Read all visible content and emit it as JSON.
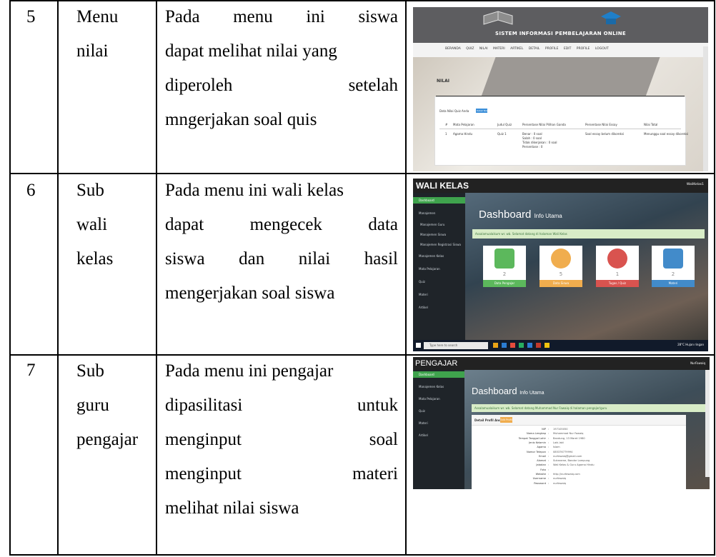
{
  "rows": [
    {
      "number": "5",
      "menu": [
        "Menu",
        "nilai"
      ],
      "description": [
        "Pada menu ini siswa",
        "dapat melihat nilai yang",
        "diperoleh setelah",
        "mngerjakan soal quis"
      ]
    },
    {
      "number": "6",
      "menu": [
        "Sub",
        "wali",
        "kelas"
      ],
      "description": [
        "Pada menu ini wali kelas",
        "dapat mengecek data",
        "siswa dan nilai hasil",
        "mengerjakan soal siswa"
      ]
    },
    {
      "number": "7",
      "menu": [
        "Sub",
        "guru",
        "pengajar"
      ],
      "description": [
        "Pada menu ini pengajar",
        "dipasilitasi untuk",
        "menginput soal",
        "menginput materi",
        "melihat nilai siswa"
      ]
    }
  ],
  "screenshot_nilai": {
    "site_title": "SISTEM INFORMASI PEMBELAJARAN ONLINE",
    "nav": "BERANDA QUIZ NILAI MATERI ARTIKEL DETAIL PROFILE EDIT PROFILE LOGOUT",
    "section_label": "NILAI",
    "panel_title": "Data Nilai Quiz Anda",
    "button": "Detail Nilai",
    "table_headers": [
      "#",
      "Mata Pelajaran",
      "Judul Quiz",
      "Persentase Nilai Pilihan Ganda",
      "Persentase Nilai Essay",
      "Nilai Total"
    ],
    "table_row": [
      "1",
      "Agama Hindu",
      "Quiz 1",
      "Benar : 0 soal",
      "Soal essay belum dikoreksi",
      "Menunggu soal essay dikoreksi"
    ],
    "extra_lines": [
      "Salah : 0 soal",
      "Tidak dikerjakan : 0 soal",
      "Persentase : 0"
    ]
  },
  "screenshot_wali": {
    "brand": "WALI KELAS",
    "user": "WaliKelas1",
    "sidebar": [
      "Dashboard",
      "Manajemen",
      "Manajemen Guru",
      "Manajemen Siswa",
      "Manajemen Registrasi Siswa",
      "Manajemen Kelas",
      "Mata Pelajaran",
      "Quiz",
      "Materi",
      "Artikel"
    ],
    "dashboard_title": "Dashboard",
    "dashboard_sub": "Info Utama",
    "alert": "Assalamualaikum wr. wb. Selamat datang di halaman Wali Kelas",
    "cards": [
      {
        "value": "2",
        "label": "Data Pengajar",
        "color": "#5cb85c"
      },
      {
        "value": "5",
        "label": "Data Siswa",
        "color": "#f0ad4e"
      },
      {
        "value": "1",
        "label": "Tugas / Quiz",
        "color": "#d9534f"
      },
      {
        "value": "2",
        "label": "Materi",
        "color": "#428bca"
      }
    ],
    "taskbar_search": "Type here to search",
    "tray": "28°C Hujan ringan"
  },
  "screenshot_pengajar": {
    "brand": "PENGAJAR",
    "user": "NurFawaiq",
    "sidebar": [
      "Dashboard",
      "Manajemen Kelas",
      "Mata Pelajaran",
      "Quiz",
      "Materi",
      "Artikel"
    ],
    "dashboard_title": "Dashboard",
    "dashboard_sub": "Info Utama",
    "alert": "Assalamualaikum wr. wb. Selamat datang Muhammad Nur Fawaiq di halaman pengajar/guru",
    "profile_title": "Detail Profil Anda",
    "profile_button": "Edit Profil",
    "profile": [
      {
        "label": "NIP",
        "value": "197105050"
      },
      {
        "label": "Nama Lengkap",
        "value": "Muhammad Nur Fawaiq"
      },
      {
        "label": "Tempat Tanggal Lahir",
        "value": "Bandung, 13 Maret 1980"
      },
      {
        "label": "Jenis Kelamin",
        "value": "Laki-laki"
      },
      {
        "label": "Agama",
        "value": "Islam"
      },
      {
        "label": "Nomor Telepon",
        "value": "085376779994"
      },
      {
        "label": "Email",
        "value": "nurfawaiq@gmail.com"
      },
      {
        "label": "Alamat",
        "value": "Sukarame, Bandar Lampung"
      },
      {
        "label": "Jabatan",
        "value": "Wali Kelas & Guru Agama Hindu"
      },
      {
        "label": "Foto",
        "value": ""
      },
      {
        "label": "Website",
        "value": "http://nurfawaiq.com"
      },
      {
        "label": "Username",
        "value": "nurfawaiq"
      },
      {
        "label": "Password",
        "value": "nurfawaiq"
      }
    ]
  }
}
